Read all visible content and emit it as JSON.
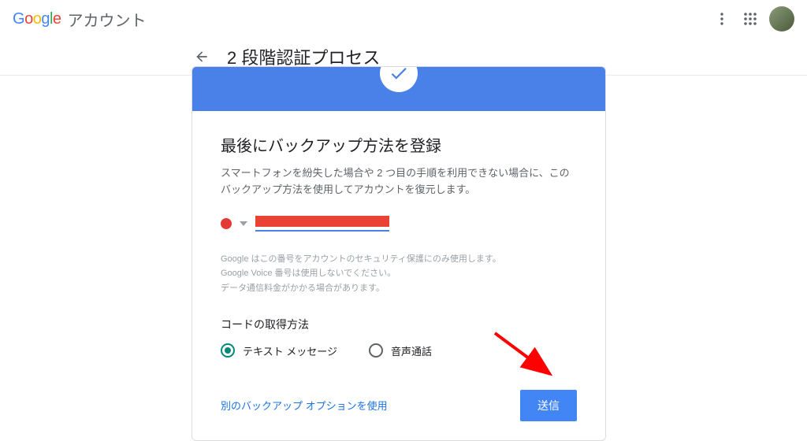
{
  "header": {
    "brand": "Google",
    "account_label": "アカウント"
  },
  "subheader": {
    "title": "2 段階認証プロセス"
  },
  "card": {
    "title": "最後にバックアップ方法を登録",
    "description": "スマートフォンを紛失した場合や 2 つ目の手順を利用できない場合に、このバックアップ方法を使用してアカウントを復元します。",
    "disclaimer_line1": "Google はこの番号をアカウントのセキュリティ保護にのみ使用します。",
    "disclaimer_line2": "Google Voice 番号は使用しないでください。",
    "disclaimer_line3": "データ通信料金がかかる場合があります。",
    "method_title": "コードの取得方法",
    "option_text": "テキスト メッセージ",
    "option_voice": "音声通話",
    "selected_option": "text",
    "alt_backup_link": "別のバックアップ オプションを使用",
    "submit_label": "送信"
  },
  "colors": {
    "primary_blue": "#4a81e8",
    "button_blue": "#4285f4",
    "link_blue": "#1a73e8",
    "radio_teal": "#00897b",
    "redacted_red": "#ea4335"
  }
}
